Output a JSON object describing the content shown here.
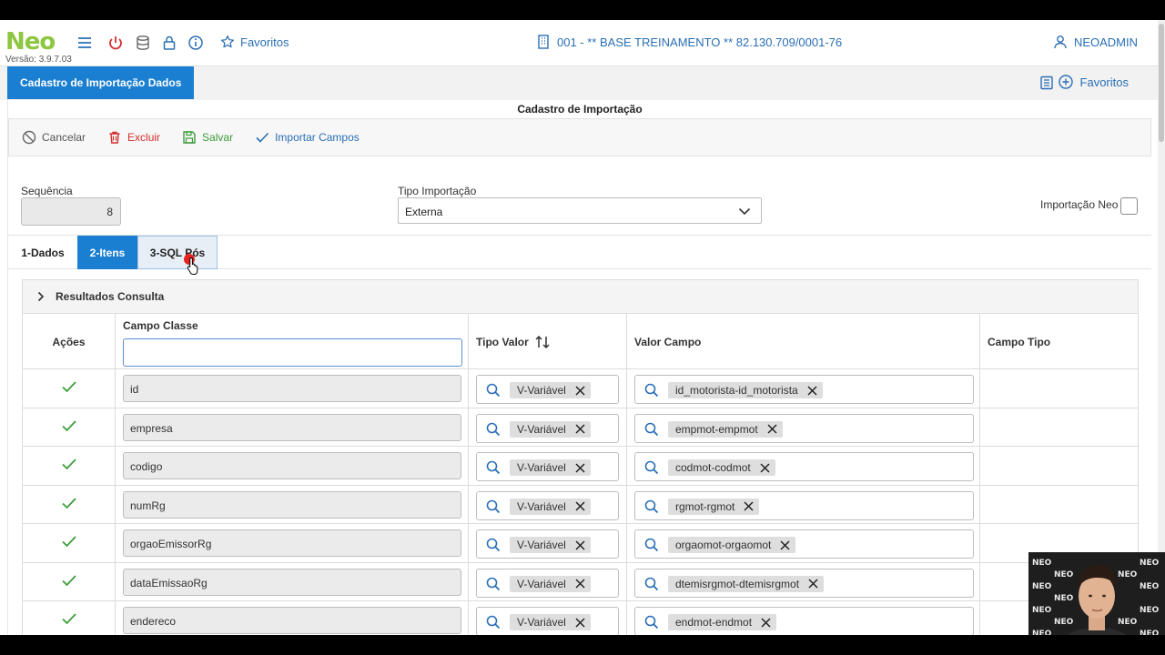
{
  "app": {
    "logo": "Neo",
    "version": "Versão: 3.9.7.03",
    "favorites_label": "Favoritos",
    "company": "001 - ** BASE TREINAMENTO ** 82.130.709/0001-76",
    "user": "NEOADMIN"
  },
  "page": {
    "tab_title": "Cadastro de Importação Dados",
    "favorites_label": "Favoritos",
    "form_title": "Cadastro de Importação"
  },
  "toolbar": {
    "cancel": "Cancelar",
    "delete": "Excluir",
    "save": "Salvar",
    "import_fields": "Importar Campos"
  },
  "form": {
    "sequence_label": "Sequência",
    "sequence_value": "8",
    "import_type_label": "Tipo Importação",
    "import_type_value": "Externa",
    "neo_import_label": "Importação Neo"
  },
  "tabs": [
    "1-Dados",
    "2-Itens",
    "3-SQL Pós"
  ],
  "section": {
    "title": "Resultados Consulta"
  },
  "grid": {
    "headers": {
      "actions": "Ações",
      "campo_classe": "Campo Classe",
      "tipo_valor": "Tipo Valor",
      "valor_campo": "Valor Campo",
      "campo_tipo": "Campo Tipo"
    },
    "filter_value": "",
    "rows": [
      {
        "campo": "id",
        "tipo": "V-Variável",
        "valor": "id_motorista-id_motorista"
      },
      {
        "campo": "empresa",
        "tipo": "V-Variável",
        "valor": "empmot-empmot"
      },
      {
        "campo": "codigo",
        "tipo": "V-Variável",
        "valor": "codmot-codmot"
      },
      {
        "campo": "numRg",
        "tipo": "V-Variável",
        "valor": "rgmot-rgmot"
      },
      {
        "campo": "orgaoEmissorRg",
        "tipo": "V-Variável",
        "valor": "orgaomot-orgaomot"
      },
      {
        "campo": "dataEmissaoRg",
        "tipo": "V-Variável",
        "valor": "dtemisrgmot-dtemisrgmot"
      },
      {
        "campo": "endereco",
        "tipo": "V-Variável",
        "valor": "endmot-endmot"
      }
    ]
  },
  "colors": {
    "brand_green": "#8dc63f",
    "accent_blue": "#1b7fd1",
    "link_blue": "#2a6fb5",
    "danger": "#d32f2f",
    "success": "#3c9d3c"
  }
}
